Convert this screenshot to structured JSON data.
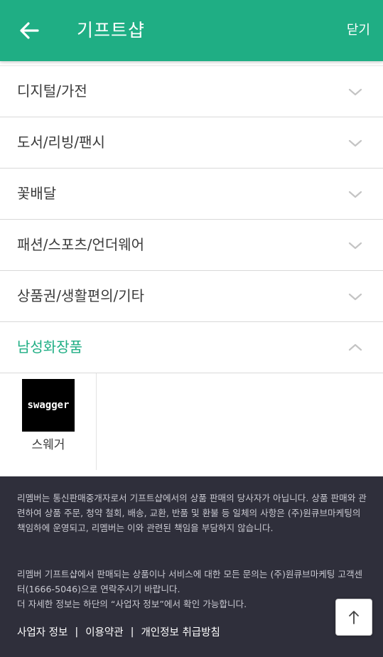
{
  "header": {
    "title": "기프트샵",
    "close_label": "닫기"
  },
  "categories": [
    {
      "label": "디지털/가전",
      "expanded": false
    },
    {
      "label": "도서/리빙/팬시",
      "expanded": false
    },
    {
      "label": "꽃배달",
      "expanded": false
    },
    {
      "label": "패션/스포츠/언더웨어",
      "expanded": false
    },
    {
      "label": "상품권/생활편의/기타",
      "expanded": false
    },
    {
      "label": "남성화장품",
      "expanded": true
    }
  ],
  "brands": [
    {
      "logo_text": "swagger",
      "name": "스웨거"
    }
  ],
  "footer": {
    "notice_1": "리멤버는 통신판매중개자로서 기프트샵에서의 상품 판매의 당사자가 아닙니다. 상품 판매와 관련하여 상품 주문, 청약 철회, 배송, 교환, 반품 및 환불 등 일체의 사항은 (주)원큐브마케팅의 책임하에 운영되고, 리멤버는 이와 관련된 책임을 부담하지 않습니다.",
    "notice_2": "리멤버 기프트샵에서 판매되는 상품이나 서비스에 대한 모든 문의는 (주)원큐브마케팅 고객센터(1666-5046)으로 연락주시기 바랍니다.",
    "notice_3": "더 자세한 정보는 하단의 “사업자 정보”에서 확인 가능합니다.",
    "links": [
      "사업자 정보",
      "이용약관",
      "개인정보 취급방침"
    ],
    "separator": "|"
  },
  "colors": {
    "brand": "#1fae84",
    "footer_bg": "#2f2f3b"
  },
  "icons": {
    "back": "arrow-left-icon",
    "collapsed": "chevron-down-icon",
    "expanded": "chevron-up-icon",
    "scroll_top": "arrow-up-icon"
  }
}
